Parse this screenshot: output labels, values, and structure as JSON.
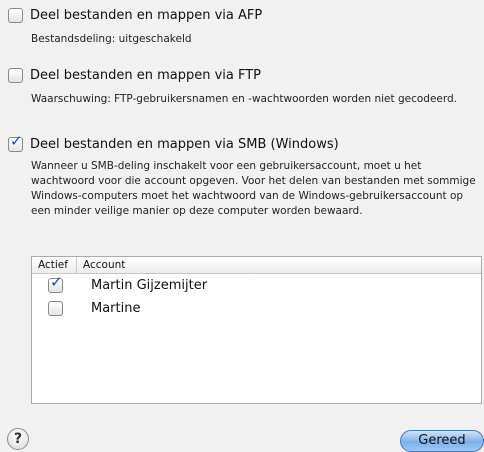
{
  "options": {
    "afp": {
      "checked": false,
      "title": "Deel bestanden en mappen via AFP",
      "description": "Bestandsdeling: uitgeschakeld"
    },
    "ftp": {
      "checked": false,
      "title": "Deel bestanden en mappen via FTP",
      "description": "Waarschuwing: FTP-gebruikersnamen en -wachtwoorden worden niet gecodeerd."
    },
    "smb": {
      "checked": true,
      "title": "Deel bestanden en mappen via SMB (Windows)",
      "description": "Wanneer u SMB-deling inschakelt voor een gebruikersaccount, moet u het wachtwoord voor die account opgeven. Voor het delen van bestanden met sommige Windows-computers moet het wachtwoord van de Windows-gebruikersaccount op een minder veilige manier op deze computer worden bewaard."
    }
  },
  "accounts_table": {
    "columns": [
      "Actief",
      "Account"
    ],
    "rows": [
      {
        "active": true,
        "account": "Martin Gijzemijter"
      },
      {
        "active": false,
        "account": "Martine"
      }
    ]
  },
  "buttons": {
    "help_label": "?",
    "done_label": "Gereed"
  },
  "colors": {
    "accent": "#1a4fa8",
    "button_blue": "#7fb0ea"
  }
}
